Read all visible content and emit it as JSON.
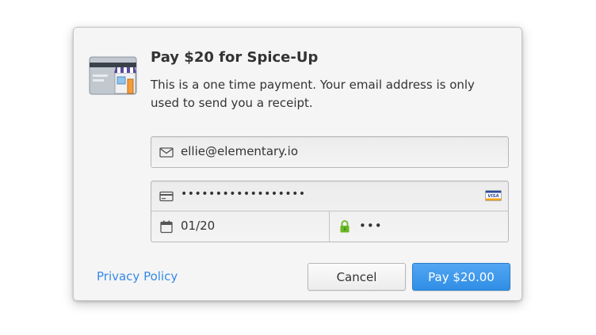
{
  "dialog": {
    "title": "Pay $20 for Spice-Up",
    "description": "This is a one time payment. Your email address is only used to send you a receipt.",
    "icon": "store-icon"
  },
  "form": {
    "email": {
      "icon": "mail-icon",
      "value": "ellie@elementary.io"
    },
    "card_number": {
      "icon": "credit-card-icon",
      "value": "••••••••••••••••••",
      "brand": "VISA",
      "brand_icon": "visa-icon"
    },
    "expiration": {
      "icon": "calendar-icon",
      "value": "01/20"
    },
    "cvc": {
      "icon": "lock-icon",
      "value": "•••"
    }
  },
  "footer": {
    "privacy_link": "Privacy Policy",
    "cancel_label": "Cancel",
    "pay_label": "Pay $20.00"
  },
  "colors": {
    "accent": "#3689e6",
    "pay_button": "#3d96ea",
    "lock_icon": "#68b723",
    "dialog_background": "#f5f5f5"
  }
}
